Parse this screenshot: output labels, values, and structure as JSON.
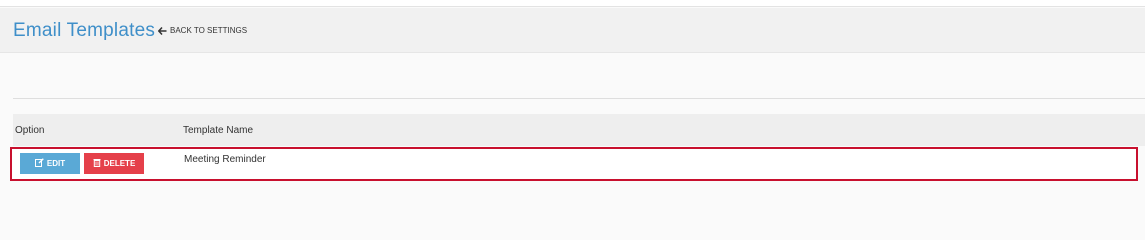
{
  "header": {
    "title": "Email Templates",
    "back_link": "BACK TO SETTINGS"
  },
  "table": {
    "columns": [
      "Option",
      "Template Name"
    ],
    "rows": [
      {
        "actions": {
          "edit": "EDIT",
          "delete": "DELETE"
        },
        "template_name": "Meeting Reminder"
      }
    ]
  },
  "colors": {
    "title": "#3f8fc9",
    "edit_button": "#5aa9d6",
    "delete_button": "#e5404a",
    "highlight_border": "#c8102e"
  },
  "icons": {
    "back": "arrow-left-icon",
    "edit": "edit-icon",
    "delete": "trash-icon"
  }
}
